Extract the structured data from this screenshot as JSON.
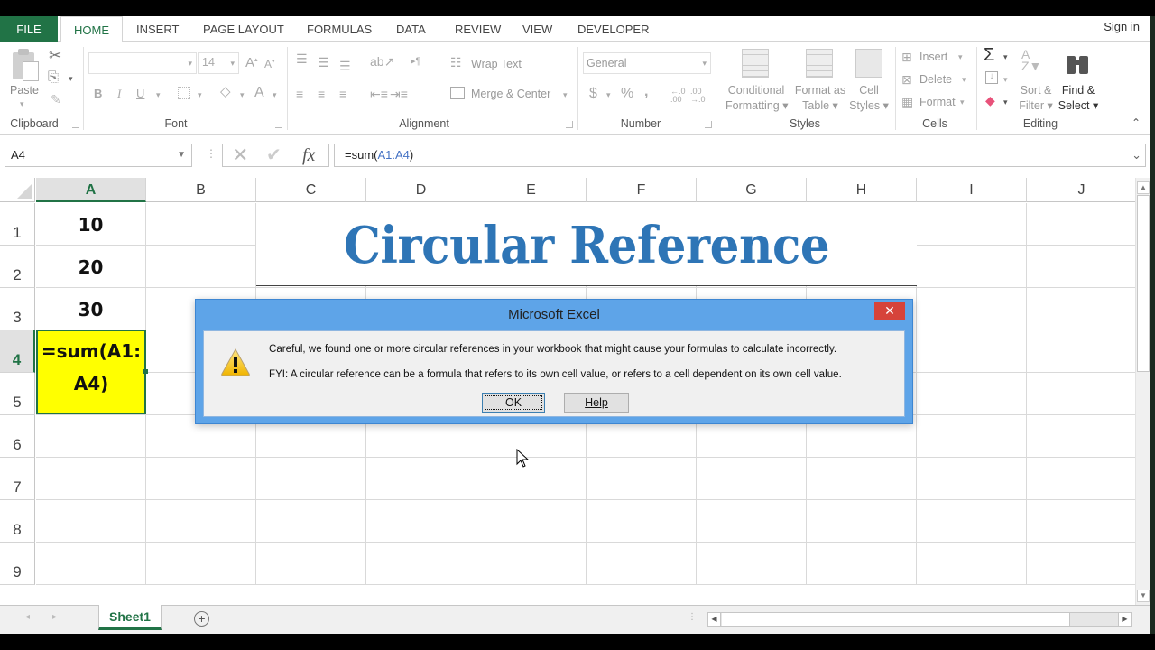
{
  "app": {
    "name": "Microsoft Excel"
  },
  "ribbon_tabs": [
    {
      "label": "FILE"
    },
    {
      "label": "HOME",
      "active": true
    },
    {
      "label": "INSERT"
    },
    {
      "label": "PAGE LAYOUT"
    },
    {
      "label": "FORMULAS"
    },
    {
      "label": "DATA"
    },
    {
      "label": "REVIEW"
    },
    {
      "label": "VIEW"
    },
    {
      "label": "DEVELOPER"
    }
  ],
  "signin_label": "Sign in",
  "ribbon": {
    "clipboard": {
      "label": "Clipboard",
      "paste": "Paste"
    },
    "font": {
      "label": "Font",
      "font_name": "",
      "font_size": "14",
      "bold": "B",
      "italic": "I",
      "underline": "U"
    },
    "alignment": {
      "label": "Alignment",
      "wrap_text": "Wrap Text",
      "merge_center": "Merge & Center"
    },
    "number": {
      "label": "Number",
      "format": "General",
      "currency": "$",
      "percent": "%",
      "comma": ","
    },
    "styles": {
      "label": "Styles",
      "conditional": [
        "Conditional",
        "Formatting"
      ],
      "format_table": [
        "Format as",
        "Table"
      ],
      "cell_styles": [
        "Cell",
        "Styles"
      ]
    },
    "cells": {
      "label": "Cells",
      "insert": "Insert",
      "delete": "Delete",
      "format": "Format"
    },
    "editing": {
      "label": "Editing",
      "sort_filter": [
        "Sort &",
        "Filter"
      ],
      "find_select": [
        "Find &",
        "Select"
      ]
    }
  },
  "formula_bar": {
    "name_box": "A4",
    "formula_prefix": "=sum(",
    "formula_ref": "A1:A4",
    "formula_suffix": ")",
    "fx_label": "fx"
  },
  "grid": {
    "columns": [
      "A",
      "B",
      "C",
      "D",
      "E",
      "F",
      "G",
      "H",
      "I",
      "J"
    ],
    "selected_column": "A",
    "rows": [
      "1",
      "2",
      "3",
      "4",
      "5",
      "6",
      "7",
      "8",
      "9"
    ],
    "selected_row": "4",
    "cells": {
      "A1": "10",
      "A2": "20",
      "A3": "30",
      "A4_line1": "=sum(A1:",
      "A4_line2": "A4)"
    },
    "title": "Circular Reference",
    "title_color": "#2e75b6",
    "highlight_color": "#ffff00"
  },
  "sheets": [
    {
      "name": "Sheet1",
      "active": true
    }
  ],
  "dialog": {
    "title": "Microsoft Excel",
    "message1": "Careful, we found one or more circular references in your workbook that might cause your formulas to calculate incorrectly.",
    "message2": "FYI: A circular reference can be a formula that refers to its own cell value, or refers to a cell dependent on its own cell value.",
    "ok_label": "OK",
    "help_label": "Help",
    "icon": "warning-icon"
  }
}
